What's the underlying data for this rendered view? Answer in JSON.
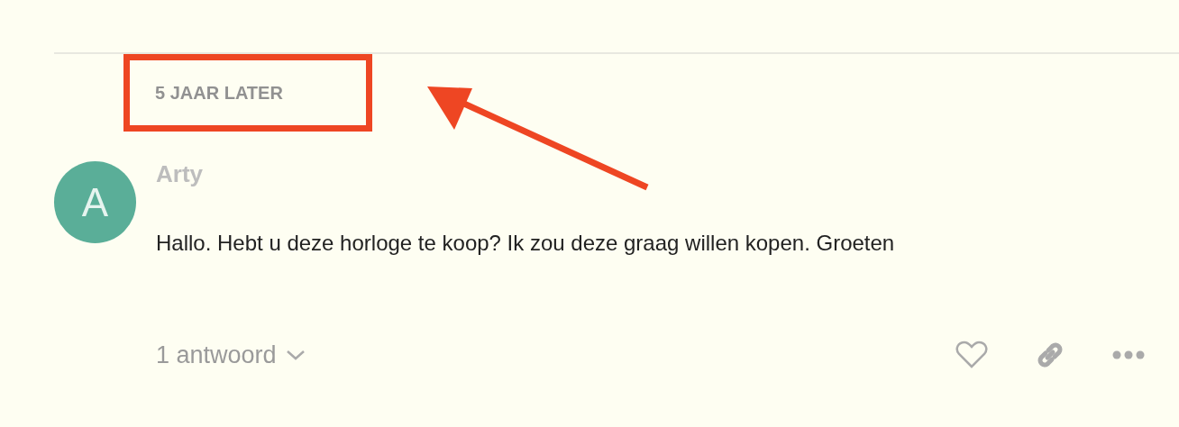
{
  "time_gap": "5 JAAR LATER",
  "comment": {
    "avatar_letter": "A",
    "author": "Arty",
    "text": "Hallo. Hebt u deze horloge te koop? Ik zou deze graag willen kopen. Groeten",
    "replies": "1 antwoord"
  }
}
